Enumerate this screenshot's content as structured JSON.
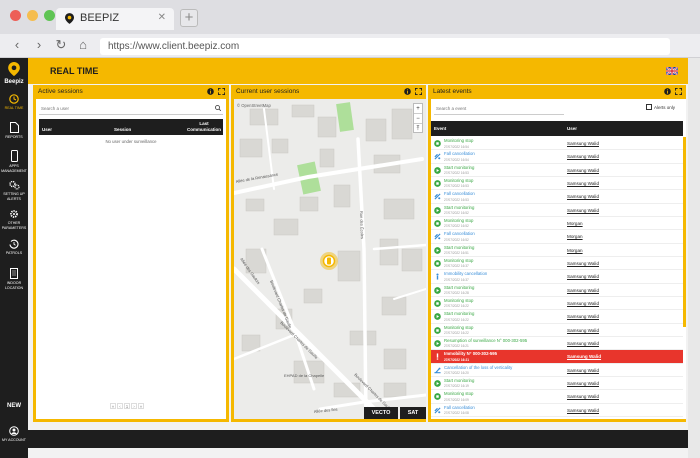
{
  "browser": {
    "tab_title": "BEEPIZ",
    "url": "https://www.client.beepiz.com",
    "colors": {
      "close": "#ed5f57",
      "minimize": "#f5bd4f",
      "maximize": "#5fc454"
    }
  },
  "brand": {
    "name": "Beepiz",
    "accent": "#f5b800",
    "dark": "#1e1e1e"
  },
  "sidebar": {
    "items": [
      {
        "label": "REAL TIME",
        "icon": "clock-icon",
        "active": true
      },
      {
        "label": "REPORTS",
        "icon": "document-icon"
      },
      {
        "label": "APPS MANAGEMENT",
        "icon": "phone-icon"
      },
      {
        "label": "SETTING UP ALERTS",
        "icon": "gears-icon"
      },
      {
        "label": "OTHER PARAMETERS",
        "icon": "gear-icon"
      },
      {
        "label": "PATROLS",
        "icon": "history-icon"
      },
      {
        "label": "INDOOR LOCATION",
        "icon": "building-icon"
      }
    ],
    "new_label": "NEW",
    "account_label": "MY ACCOUNT"
  },
  "header": {
    "title": "REAL TIME",
    "language_icon": "uk-flag-icon"
  },
  "active_sessions": {
    "title": "Active sessions",
    "search_placeholder": "Search a user",
    "columns": [
      "User",
      "Session",
      "Last Communication"
    ],
    "empty_text": "No user under surveillance",
    "pager": [
      "«",
      "‹",
      "1",
      "›",
      "»"
    ]
  },
  "current_sessions": {
    "title": "Current user sessions",
    "attribution": "© OpenStreetMap",
    "zoom": [
      "+",
      "−",
      "⤒"
    ],
    "streets": [
      "Allée de la Renaissance",
      "Rue des Écoles",
      "Allée des Gaulois",
      "Boulevard Charles de Gaulle",
      "Boulevard Charles de Gaulle",
      "Boulevard Charles de Gaulle",
      "EHPAD de la Chapelle",
      "Allée des Iles"
    ],
    "layer_buttons": [
      "VECTO",
      "SAT"
    ]
  },
  "latest_events": {
    "title": "Latest events",
    "search_placeholder": "Search a event",
    "alerts_only_label": "Alerts only",
    "columns": [
      "Event",
      "User"
    ],
    "rows": [
      {
        "type": "stop",
        "title": "Monitoring stop",
        "time": "27/07/2022 16:54",
        "user": "Samsung Walid"
      },
      {
        "type": "fall",
        "title": "Fall cancellation",
        "time": "27/07/2022 16:54",
        "user": "Samsung Walid"
      },
      {
        "type": "start",
        "title": "Start monitoring",
        "time": "27/07/2022 16:53",
        "user": "Samsung Walid"
      },
      {
        "type": "stop",
        "title": "Monitoring stop",
        "time": "27/07/2022 16:53",
        "user": "Samsung Walid"
      },
      {
        "type": "fall",
        "title": "Fall cancellation",
        "time": "27/07/2022 16:53",
        "user": "Samsung Walid"
      },
      {
        "type": "start",
        "title": "Start monitoring",
        "time": "27/07/2022 16:52",
        "user": "Samsung Walid"
      },
      {
        "type": "stop",
        "title": "Monitoring stop",
        "time": "27/07/2022 16:52",
        "user": "Morgan"
      },
      {
        "type": "fall",
        "title": "Fall cancellation",
        "time": "27/07/2022 16:52",
        "user": "Morgan"
      },
      {
        "type": "start",
        "title": "Start monitoring",
        "time": "27/07/2022 16:51",
        "user": "Morgan"
      },
      {
        "type": "stop",
        "title": "Monitoring stop",
        "time": "27/07/2022 16:37",
        "user": "Samsung Walid"
      },
      {
        "type": "immob",
        "title": "Immobility cancellation",
        "time": "27/07/2022 16:37",
        "user": "Samsung Walid"
      },
      {
        "type": "start",
        "title": "Start monitoring",
        "time": "27/07/2022 16:28",
        "user": "Samsung Walid"
      },
      {
        "type": "stop",
        "title": "Monitoring stop",
        "time": "27/07/2022 16:22",
        "user": "Samsung Walid"
      },
      {
        "type": "start",
        "title": "Start monitoring",
        "time": "27/07/2022 16:22",
        "user": "Samsung Walid"
      },
      {
        "type": "stop",
        "title": "Monitoring stop",
        "time": "27/07/2022 16:22",
        "user": "Samsung Walid"
      },
      {
        "type": "start",
        "title": "Resumption of surveillance N° 000-302-595",
        "time": "27/07/2022 16:21",
        "user": "Samsung Walid"
      },
      {
        "type": "alert",
        "title": "Immobility N° 000-302-595",
        "time": "27/07/2022 16:21",
        "user": "Samsung Walid"
      },
      {
        "type": "verticality",
        "title": "Cancellation of the loss of verticality",
        "time": "27/07/2022 16:20",
        "user": "Samsung Walid"
      },
      {
        "type": "start",
        "title": "Start monitoring",
        "time": "27/07/2022 16:19",
        "user": "Samsung Walid"
      },
      {
        "type": "stop",
        "title": "Monitoring stop",
        "time": "27/07/2022 16:09",
        "user": "Samsung Walid"
      },
      {
        "type": "fall",
        "title": "Fall cancellation",
        "time": "27/07/2022 16:08",
        "user": "Samsung Walid"
      }
    ]
  }
}
